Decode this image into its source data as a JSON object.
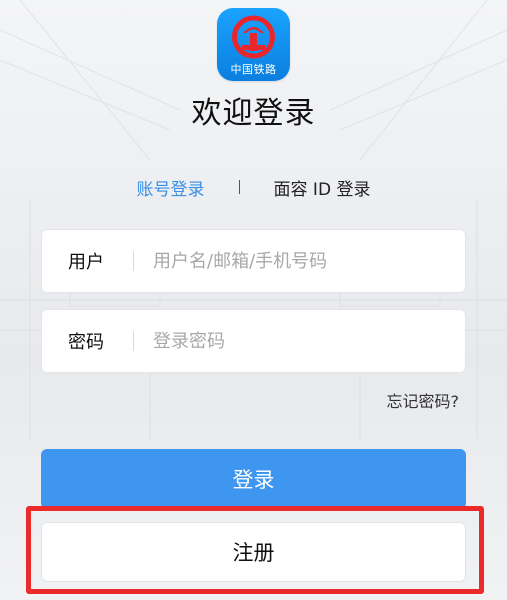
{
  "app_logo": {
    "icon": "china-railway-logo-icon",
    "caption": "中国铁路",
    "color": "#1595f5"
  },
  "page_title": "欢迎登录",
  "login_tabs": {
    "account_login": "账号登录",
    "separator": "|",
    "face_id_login": "面容 ID 登录",
    "active": "account_login",
    "active_color": "#3b8ee5"
  },
  "form": {
    "username": {
      "label": "用户",
      "placeholder": "用户名/邮箱/手机号码",
      "value": ""
    },
    "password": {
      "label": "密码",
      "placeholder": "登录密码",
      "value": ""
    }
  },
  "forgot_password": "忘记密码?",
  "buttons": {
    "login": "登录",
    "register": "注册",
    "login_color": "#3f96f0"
  },
  "highlight": {
    "target": "register",
    "color": "#ec2a2a"
  }
}
